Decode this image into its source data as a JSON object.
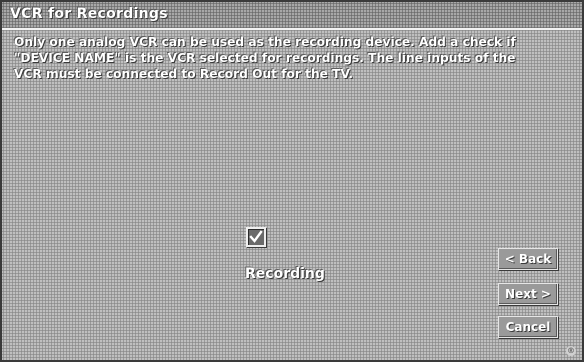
{
  "window": {
    "title": "VCR for Recordings"
  },
  "instructions": {
    "lines": [
      "Only one analog VCR can be used as the recording device.  Add a check if",
      "\"DEVICE NAME\" is the VCR selected for recordings.  The line inputs of the",
      "VCR must be connected to Record Out for the TV."
    ]
  },
  "recording": {
    "label": "Recording",
    "checked": true
  },
  "buttons": {
    "back_label": "< Back",
    "next_label": "Next >",
    "cancel_label": "Cancel"
  },
  "corner_mark": {
    "symbol": "®"
  },
  "colors": {
    "background": "#a9a9a9",
    "titlebar": "#8e8e8e",
    "text": "#ffffff"
  }
}
